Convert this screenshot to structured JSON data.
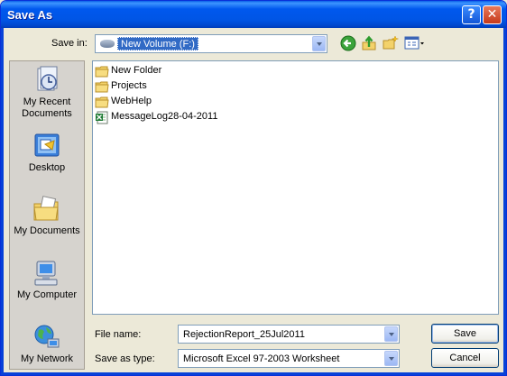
{
  "window": {
    "title": "Save As",
    "help_label": "?",
    "close_label": "✕"
  },
  "toolbar": {
    "save_in_label": "Save in:",
    "save_in_value": "New Volume (F:)",
    "icons": [
      "back-icon",
      "up-folder-icon",
      "new-folder-icon",
      "views-menu-icon"
    ]
  },
  "places": [
    {
      "label_1": "My Recent",
      "label_2": "Documents",
      "icon": "recent-documents-icon"
    },
    {
      "label_1": "Desktop",
      "icon": "desktop-icon"
    },
    {
      "label_1": "My Documents",
      "icon": "my-documents-icon"
    },
    {
      "label_1": "My Computer",
      "icon": "my-computer-icon"
    },
    {
      "label_1": "My Network",
      "icon": "my-network-icon"
    }
  ],
  "files": [
    {
      "name": "New Folder",
      "icon": "folder-icon"
    },
    {
      "name": "Projects",
      "icon": "folder-icon"
    },
    {
      "name": "WebHelp",
      "icon": "folder-icon"
    },
    {
      "name": "MessageLog28-04-2011",
      "icon": "excel-file-icon"
    }
  ],
  "form": {
    "file_name_label": "File name:",
    "file_name_value": "RejectionReport_25Jul2011",
    "save_as_type_label": "Save as type:",
    "save_as_type_value": "Microsoft Excel 97-2003 Worksheet"
  },
  "buttons": {
    "save": "Save",
    "cancel": "Cancel"
  },
  "colors": {
    "titlebar": "#0055E5",
    "selection": "#316AC5",
    "dialog_bg": "#ECE9D8"
  }
}
